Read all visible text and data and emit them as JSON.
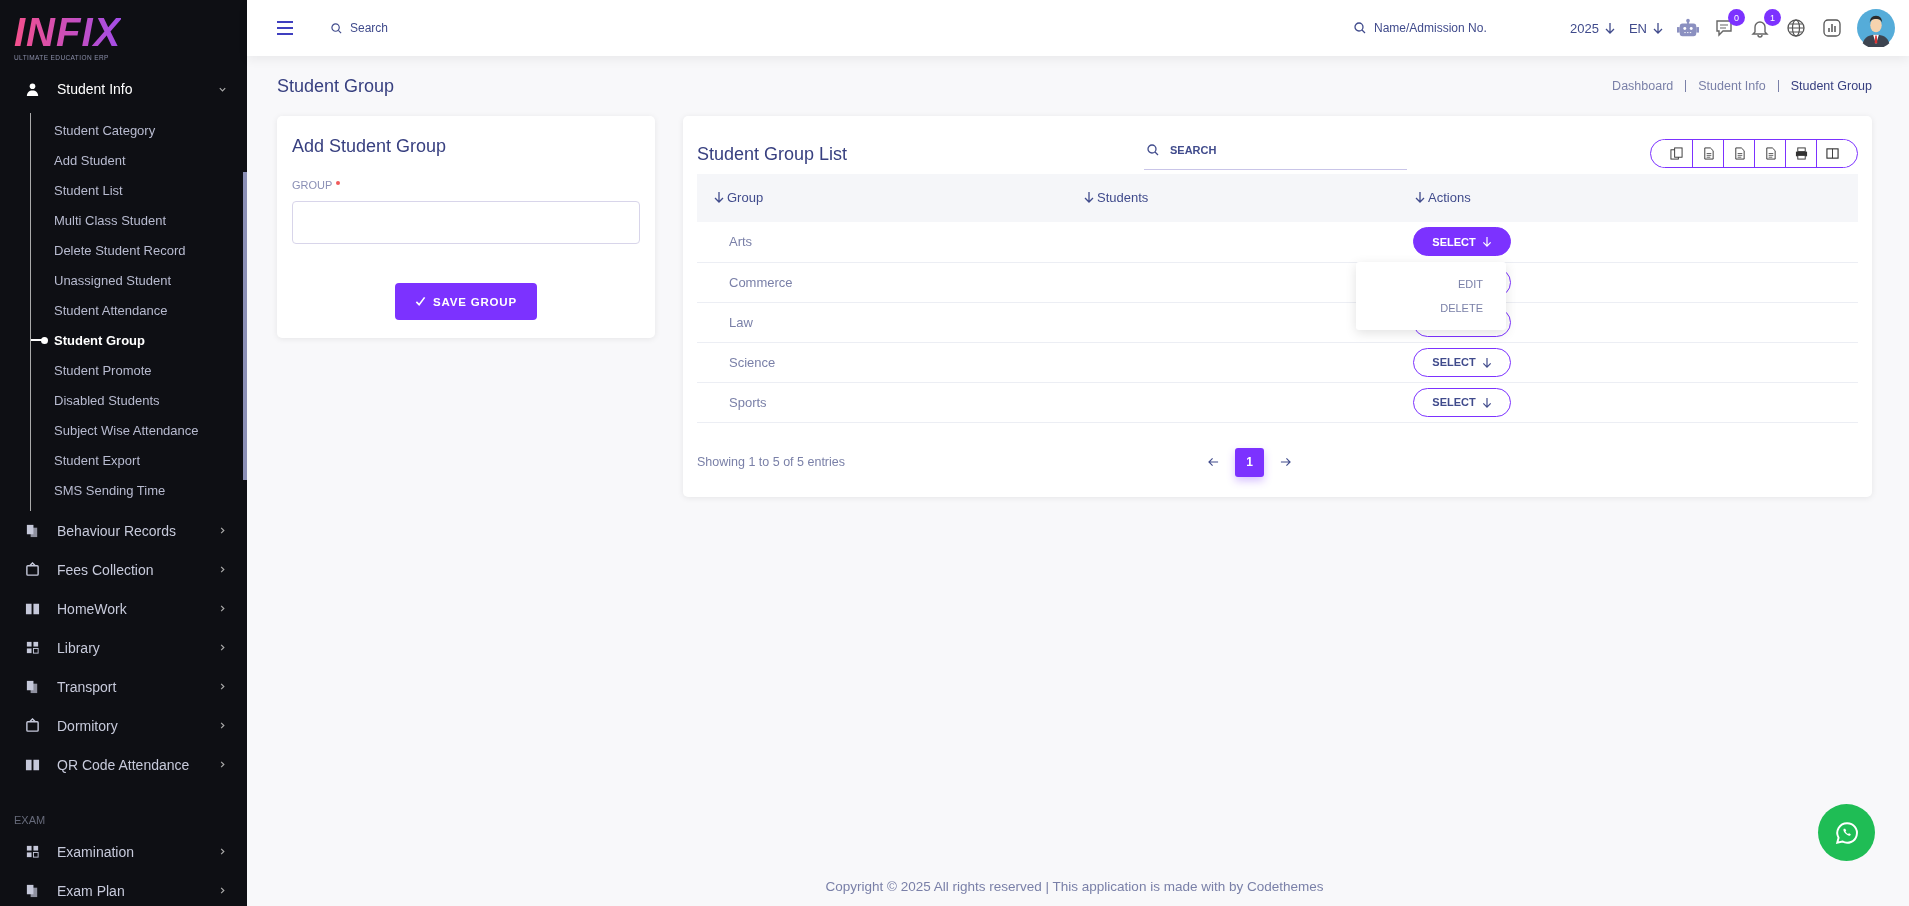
{
  "sidebar": {
    "logo": {
      "name": "INFIX",
      "tagline": "ULTIMATE EDUCATION ERP"
    },
    "groups": [
      {
        "items": [
          {
            "label": "Student Info",
            "expanded": true,
            "children": [
              {
                "label": "Student Category",
                "selected": false
              },
              {
                "label": "Add Student",
                "selected": false
              },
              {
                "label": "Student List",
                "selected": false
              },
              {
                "label": "Multi Class Student",
                "selected": false
              },
              {
                "label": "Delete Student Record",
                "selected": false
              },
              {
                "label": "Unassigned Student",
                "selected": false
              },
              {
                "label": "Student Attendance",
                "selected": false
              },
              {
                "label": "Student Group",
                "selected": true
              },
              {
                "label": "Student Promote",
                "selected": false
              },
              {
                "label": "Disabled Students",
                "selected": false
              },
              {
                "label": "Subject Wise Attendance",
                "selected": false
              },
              {
                "label": "Student Export",
                "selected": false
              },
              {
                "label": "SMS Sending Time",
                "selected": false
              }
            ]
          },
          {
            "label": "Behaviour Records",
            "expanded": false
          },
          {
            "label": "Fees Collection",
            "expanded": false
          },
          {
            "label": "HomeWork",
            "expanded": false
          },
          {
            "label": "Library",
            "expanded": false
          },
          {
            "label": "Transport",
            "expanded": false
          },
          {
            "label": "Dormitory",
            "expanded": false
          },
          {
            "label": "QR Code Attendance",
            "expanded": false
          }
        ]
      },
      {
        "label": "EXAM",
        "items": [
          {
            "label": "Examination",
            "expanded": false
          },
          {
            "label": "Exam Plan",
            "expanded": false
          }
        ]
      }
    ]
  },
  "topbar": {
    "search": {
      "placeholder": "Search"
    },
    "student_search": {
      "placeholder": "Name/Admission No."
    },
    "year": "2025",
    "language": "EN",
    "messages_badge": "0",
    "notifications_badge": "1"
  },
  "page": {
    "title": "Student Group",
    "breadcrumb": [
      {
        "label": "Dashboard",
        "current": false
      },
      {
        "label": "Student Info",
        "current": false
      },
      {
        "label": "Student Group",
        "current": true
      }
    ]
  },
  "add_form": {
    "title": "Add Student Group",
    "field_label": "GROUP",
    "required": true,
    "submit": "SAVE GROUP"
  },
  "list": {
    "title": "Student Group List",
    "search": {
      "placeholder": "SEARCH"
    },
    "columns": [
      "Group",
      "Students",
      "Actions"
    ],
    "rows": [
      {
        "group": "Arts",
        "action": "SELECT",
        "open": true
      },
      {
        "group": "Commerce",
        "open": false
      },
      {
        "group": "Law",
        "open": false
      },
      {
        "group": "Science",
        "action": "SELECT",
        "open": false
      },
      {
        "group": "Sports",
        "action": "SELECT",
        "open": false
      }
    ],
    "menu": [
      "EDIT",
      "DELETE"
    ],
    "summary": "Showing 1 to 5 of 5 entries",
    "pages": [
      {
        "label": "1",
        "selected": true
      }
    ]
  },
  "footer": "Copyright © 2025 All rights reserved | This application is made with by Codethemes"
}
